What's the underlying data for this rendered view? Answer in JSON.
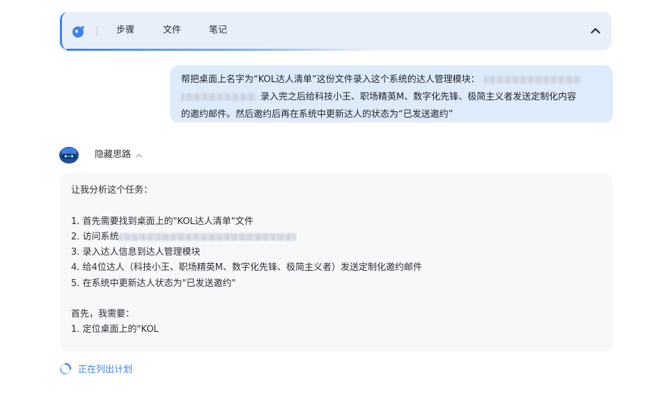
{
  "toolbar": {
    "logo_icon": "assistant-logo-icon",
    "tabs": [
      {
        "label": "步骤"
      },
      {
        "label": "文件"
      },
      {
        "label": "笔记"
      }
    ],
    "collapse_icon": "chevron-up-icon",
    "accent": "#3b82f6"
  },
  "user_message": {
    "line1": "帮把桌面上名字为“KOL达人清单”这份文件录入这个系统的达人管理模块：",
    "line2": "录入完之后给科技小王、职场精英M、数字化先锋、极简主义者发送定制化内容",
    "line3": "的邀约邮件。然后邀约后再在系统中更新达人的状态为“已发送邀约”",
    "bubble_color": "#ddebfb"
  },
  "assistant": {
    "avatar_icon": "robot-avatar-icon",
    "thinking_label": "隐藏思路",
    "thinking": {
      "intro": "让我分析这个任务：",
      "steps": [
        "1. 首先需要找到桌面上的\"KOL达人清单\"文件",
        "2. 访问系统",
        "3. 录入达人信息到达人管理模块",
        "4. 给4位达人（科技小王、职场精英M、数字化先锋、极简主义者）发送定制化邀约邮件",
        "5. 在系统中更新达人状态为\"已发送邀约\""
      ],
      "followup": "首先，我需要：",
      "partial": "1. 定位桌面上的\"KOL"
    }
  },
  "status": {
    "label": "正在列出计划",
    "icon": "loading-spinner-icon",
    "color": "#3b82f6"
  }
}
